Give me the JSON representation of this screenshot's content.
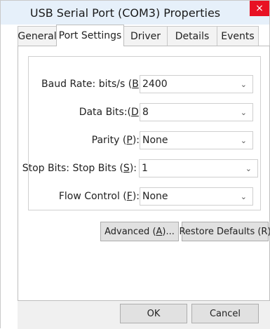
{
  "window": {
    "title": "USB Serial Port (COM3) Properties",
    "close_glyph": "×"
  },
  "tabs": [
    {
      "label": "General",
      "active": false
    },
    {
      "label": "Port Settings",
      "active": true
    },
    {
      "label": "Driver",
      "active": false
    },
    {
      "label": "Details",
      "active": false
    },
    {
      "label": "Events",
      "active": false
    }
  ],
  "settings": {
    "baud": {
      "label_pre": "Baud Rate: bits/s (",
      "mnemonic": "B",
      "label_post": "):",
      "value": "2400"
    },
    "data_bits": {
      "label_pre": "Data Bits:(",
      "mnemonic": "D",
      "label_post": "):",
      "value": "8"
    },
    "parity": {
      "label_pre": "Parity (",
      "mnemonic": "P",
      "label_post": "):",
      "value": "None"
    },
    "stop_bits": {
      "label_pre": "Stop Bits: Stop Bits (",
      "mnemonic": "S",
      "label_post": "):",
      "value": "1"
    },
    "flow": {
      "label_pre": "Flow Control (",
      "mnemonic": "F",
      "label_post": "):",
      "value": "None"
    }
  },
  "buttons": {
    "advanced_pre": "Advanced (",
    "advanced_mnemonic": "A",
    "advanced_post": ")...",
    "restore": "Restore Defaults (R)",
    "ok": "OK",
    "cancel": "Cancel"
  },
  "colors": {
    "titlebar": "#e6f0fa",
    "close": "#e81123"
  },
  "icons": {
    "dropdown": "chevron-down-icon",
    "close": "close-icon"
  }
}
